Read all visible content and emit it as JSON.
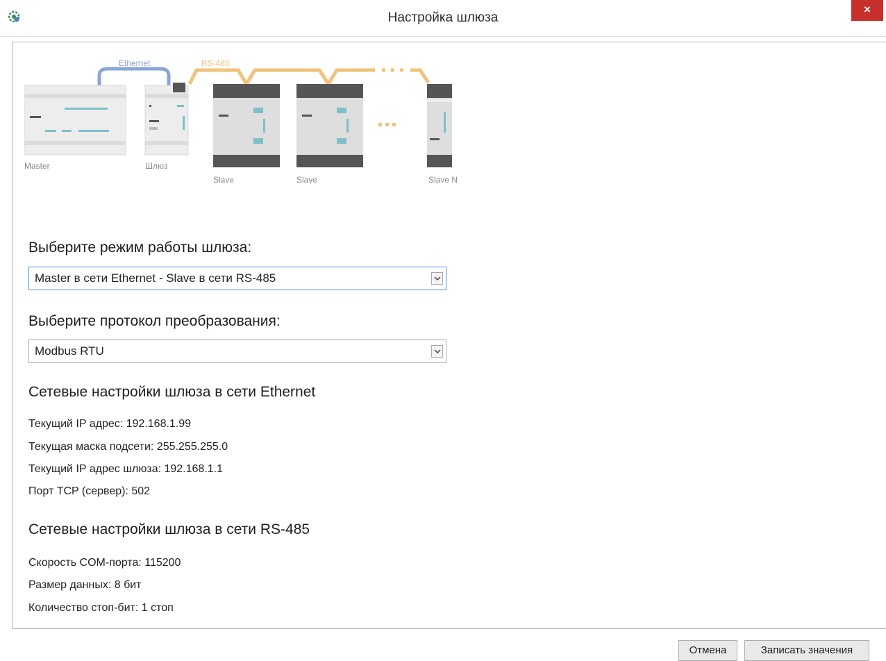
{
  "window": {
    "title": "Настройка шлюза",
    "close_glyph": "×"
  },
  "diagram": {
    "ethernet_label": "Ethernet",
    "rs485_label": "RS-485",
    "master_label": "Master",
    "gateway_label": "Шлюз",
    "slave_label": "Slave",
    "slave_n_label": "Slave N",
    "ethernet_color": "#8aa6d6",
    "rs485_color": "#f0c27a"
  },
  "mode": {
    "heading": "Выберите режим работы шлюза:",
    "selected": "Master в сети Ethernet - Slave в сети RS-485"
  },
  "protocol": {
    "heading": "Выберите протокол преобразования:",
    "selected": "Modbus RTU"
  },
  "ethernet_settings": {
    "title": "Сетевые настройки шлюза в сети Ethernet",
    "rows": [
      "Текущий IP адрес: 192.168.1.99",
      "Текущая маска подсети: 255.255.255.0",
      "Текущий IP адрес шлюза: 192.168.1.1",
      "Порт TCP (сервер): 502"
    ]
  },
  "rs485_settings": {
    "title": "Сетевые настройки шлюза в сети RS-485",
    "rows": [
      "Скорость COM-порта: 115200",
      "Размер данных: 8 бит",
      "Количество стоп-бит: 1 стоп"
    ]
  },
  "footer": {
    "cancel_label": "Отмена",
    "write_label": "Записать значения"
  }
}
